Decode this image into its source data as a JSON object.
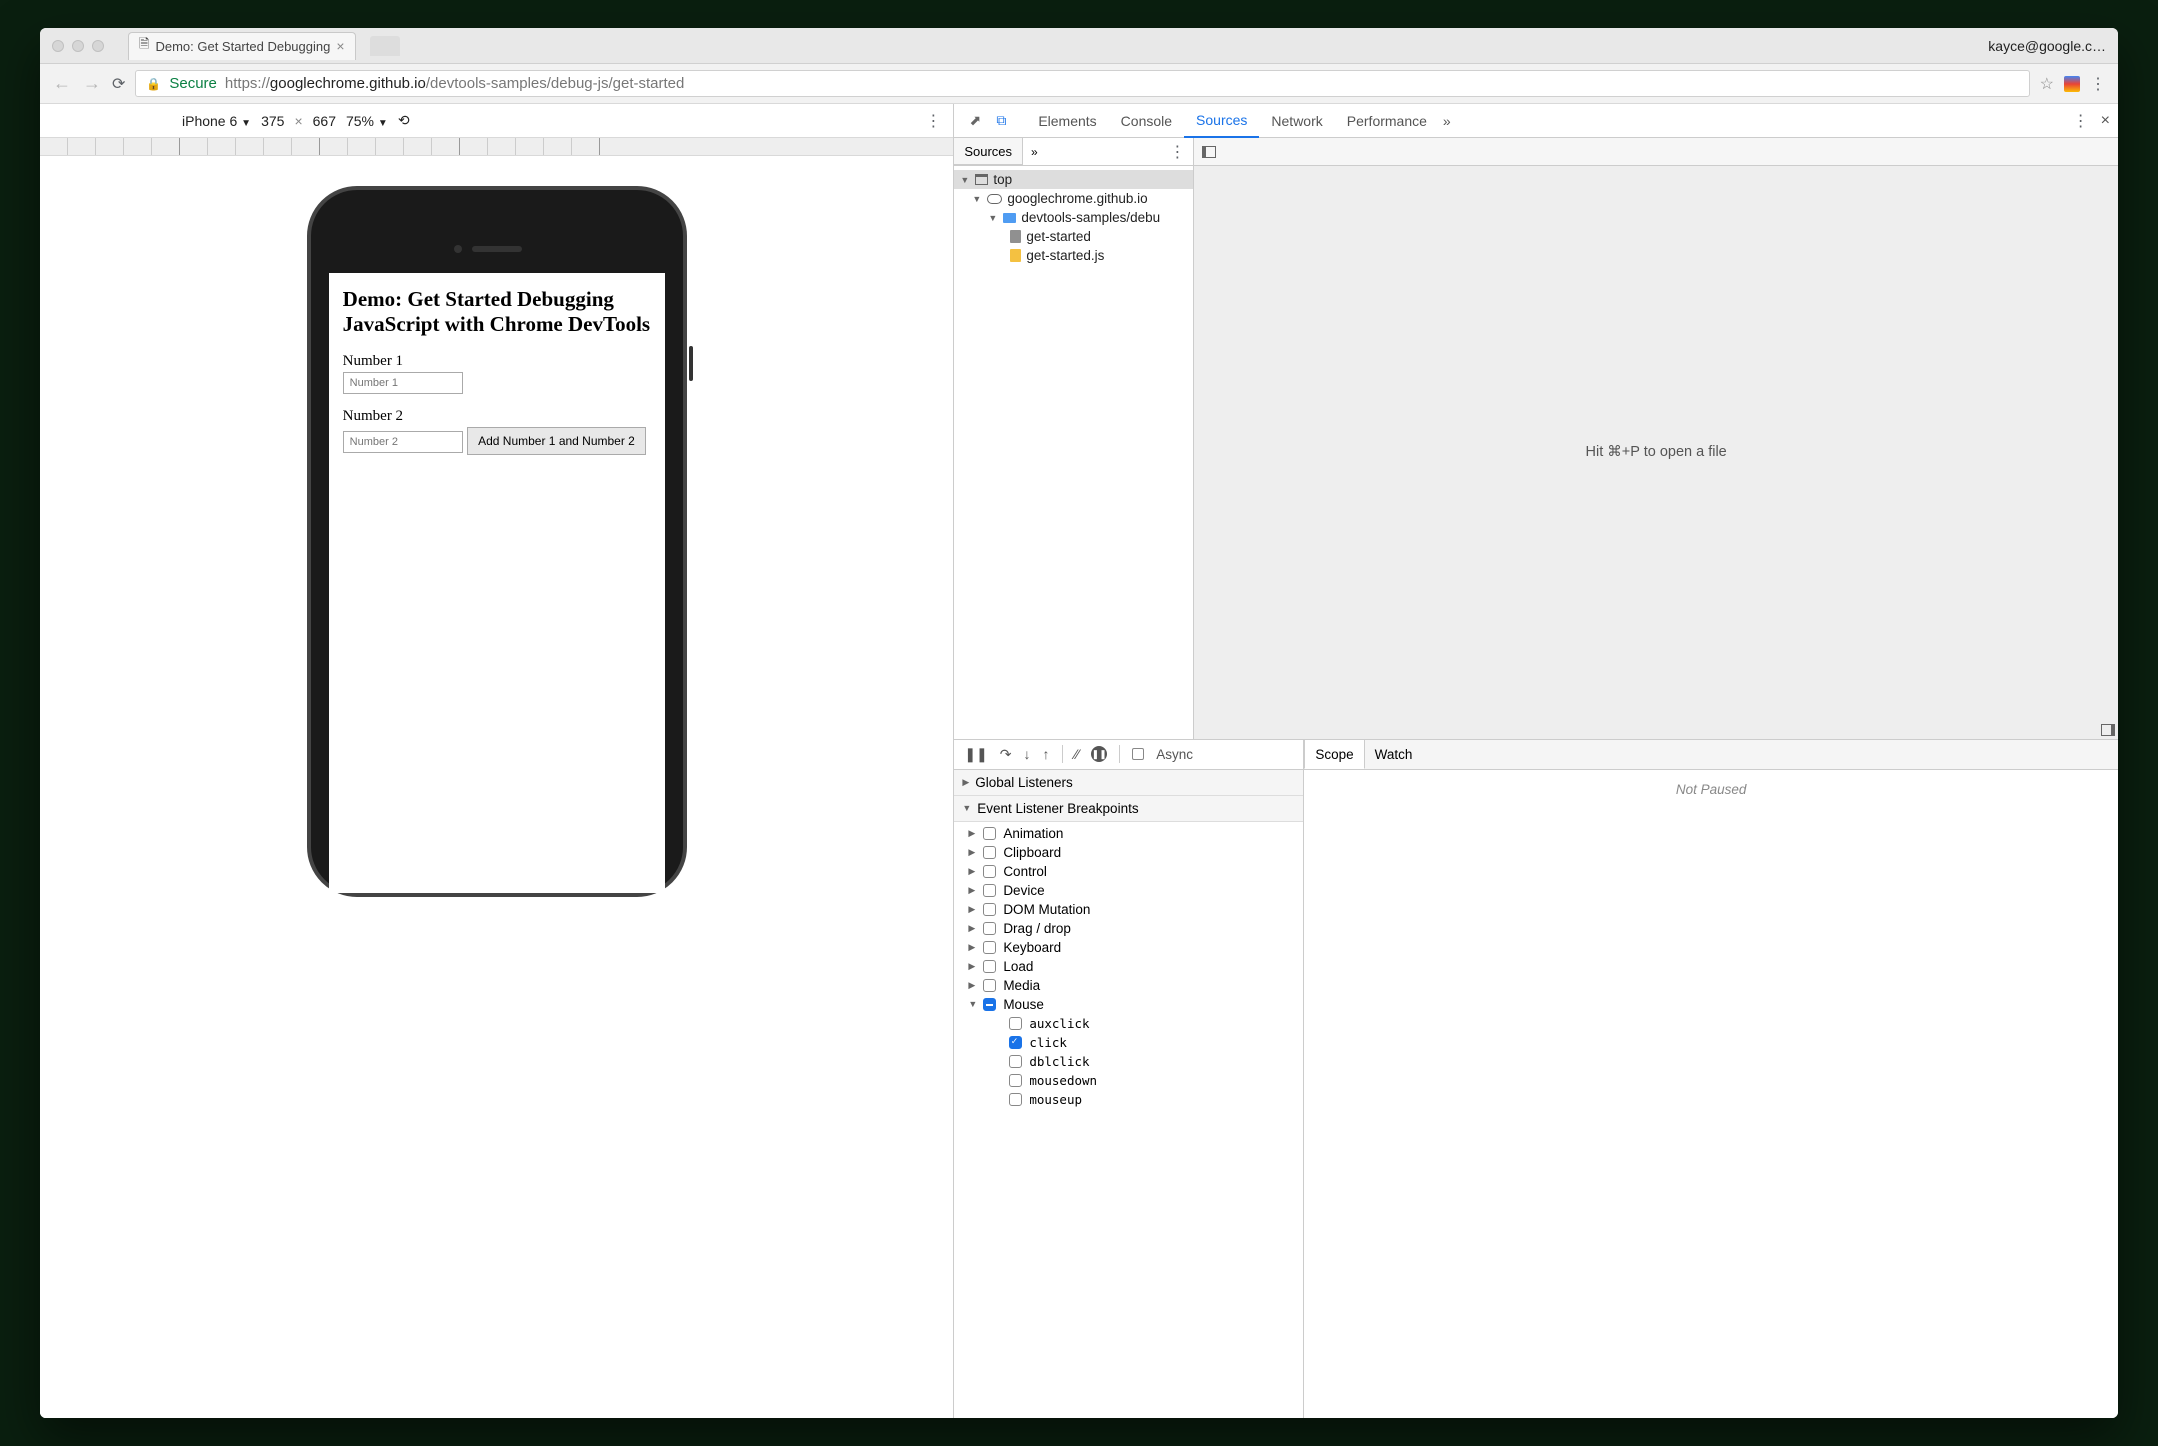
{
  "browser": {
    "tab_title": "Demo: Get Started Debugging",
    "user": "kayce@google.c…",
    "secure": "Secure",
    "url_prefix": "https://",
    "url_host": "googlechrome.github.io",
    "url_path": "/devtools-samples/debug-js/get-started"
  },
  "device_toolbar": {
    "device": "iPhone 6",
    "width": "375",
    "x": "×",
    "height": "667",
    "zoom": "75%"
  },
  "page": {
    "heading": "Demo: Get Started Debugging JavaScript with Chrome DevTools",
    "label1": "Number 1",
    "placeholder1": "Number 1",
    "label2": "Number 2",
    "placeholder2": "Number 2",
    "button": "Add Number 1 and Number 2"
  },
  "devtools": {
    "tabs": [
      "Elements",
      "Console",
      "Sources",
      "Network",
      "Performance"
    ],
    "active_tab": "Sources",
    "nav_tab": "Sources",
    "tree": {
      "top": "top",
      "host": "googlechrome.github.io",
      "folder": "devtools-samples/debu",
      "file1": "get-started",
      "file2": "get-started.js"
    },
    "editor_hint": "Hit ⌘+P to open a file",
    "async": "Async",
    "sections": {
      "global": "Global Listeners",
      "elb": "Event Listener Breakpoints"
    },
    "categories": [
      "Animation",
      "Clipboard",
      "Control",
      "Device",
      "DOM Mutation",
      "Drag / drop",
      "Keyboard",
      "Load",
      "Media"
    ],
    "mouse_label": "Mouse",
    "mouse_events": [
      "auxclick",
      "click",
      "dblclick",
      "mousedown",
      "mouseup"
    ],
    "mouse_checked": "click",
    "scope_tabs": [
      "Scope",
      "Watch"
    ],
    "scope_msg": "Not Paused"
  }
}
